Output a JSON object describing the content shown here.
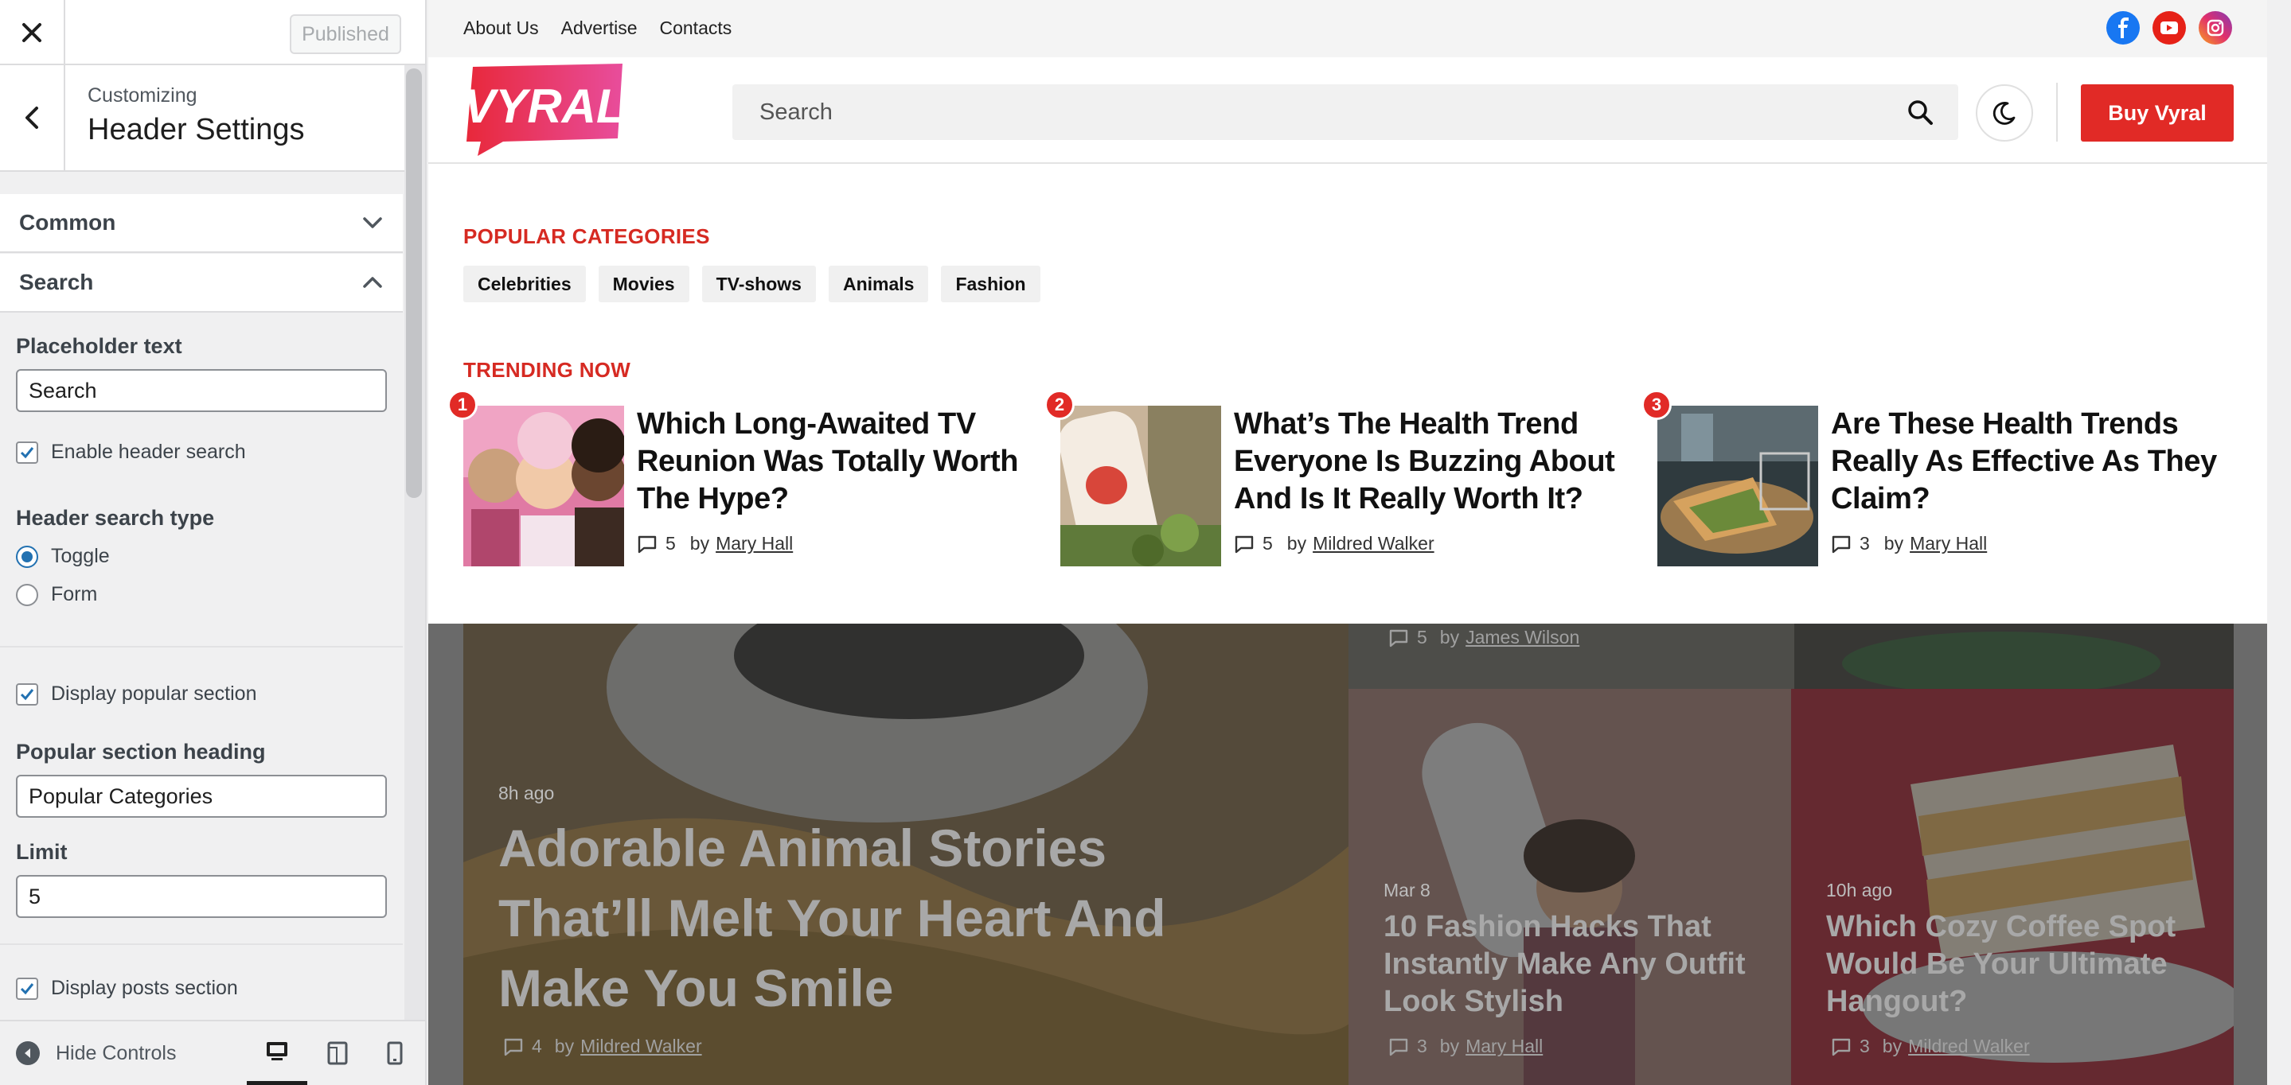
{
  "sidebar": {
    "published_label": "Published",
    "crumb": "Customizing",
    "title": "Header Settings",
    "sections": [
      {
        "label": "Common"
      },
      {
        "label": "Search"
      }
    ],
    "fields": {
      "placeholder_label": "Placeholder text",
      "placeholder_value": "Search",
      "enable_search_label": "Enable header search",
      "search_type_label": "Header search type",
      "search_type_options": [
        "Toggle",
        "Form"
      ],
      "search_type_selected": "Toggle",
      "display_popular_label": "Display popular section",
      "popular_heading_label": "Popular section heading",
      "popular_heading_value": "Popular Categories",
      "limit_label": "Limit",
      "limit_value": "5",
      "display_posts_label": "Display posts section"
    },
    "footer": {
      "hide_controls": "Hide Controls"
    }
  },
  "preview": {
    "toplinks": [
      "About Us",
      "Advertise",
      "Contacts"
    ],
    "logo_text": "VYRAL",
    "search_placeholder": "Search",
    "buy_label": "Buy Vyral",
    "popular_heading": "POPULAR CATEGORIES",
    "categories": [
      "Celebrities",
      "Movies",
      "TV-shows",
      "Animals",
      "Fashion"
    ],
    "trending_heading": "TRENDING NOW",
    "trending": [
      {
        "num": "1",
        "title": "Which Long-Awaited TV Reunion Was Totally Worth The Hype?",
        "comments": "5",
        "by": "by",
        "author": "Mary Hall"
      },
      {
        "num": "2",
        "title": "What’s The Health Trend Everyone Is Buzzing About And Is It Really Worth It?",
        "comments": "5",
        "by": "by",
        "author": "Mildred Walker"
      },
      {
        "num": "3",
        "title": "Are These Health Trends Really As Effective As They Claim?",
        "comments": "3",
        "by": "by",
        "author": "Mary Hall"
      }
    ],
    "hero": {
      "main": {
        "time": "8h ago",
        "title": "Adorable Animal Stories That’ll Melt Your Heart And Make You Smile",
        "comments": "4",
        "by": "by",
        "author": "Mildred Walker"
      },
      "top": {
        "comments": "5",
        "by": "by",
        "author": "James Wilson"
      },
      "left": {
        "time": "Mar 8",
        "title": "10 Fashion Hacks That Instantly Make Any Outfit Look Stylish",
        "comments": "3",
        "by": "by",
        "author": "Mary Hall"
      },
      "right": {
        "time": "10h ago",
        "title": "Which Cozy Coffee Spot Would Be Your Ultimate Hangout?",
        "comments": "3",
        "by": "by",
        "author": "Mildred Walker"
      }
    },
    "colors": {
      "accent": "#e12a26",
      "logo_pink": "#e83e8c"
    }
  }
}
